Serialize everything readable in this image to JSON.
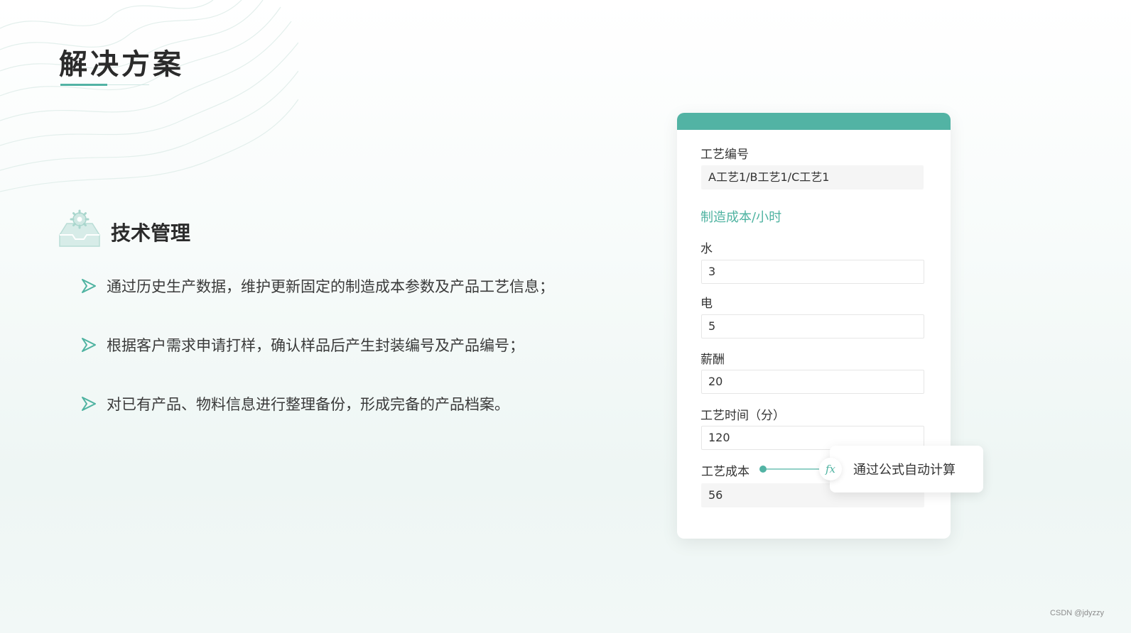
{
  "page": {
    "title": "解决方案"
  },
  "section": {
    "title": "技术管理",
    "bullets": [
      "通过历史生产数据，维护更新固定的制造成本参数及产品工艺信息；",
      "根据客户需求申请打样，确认样品后产生封装编号及产品编号；",
      "对已有产品、物料信息进行整理备份，形成完备的产品档案。"
    ]
  },
  "card": {
    "process_no_label": "工艺编号",
    "process_no_value": "A工艺1/B工艺1/C工艺1",
    "cost_section_label": "制造成本/小时",
    "water_label": "水",
    "water_value": "3",
    "electric_label": "电",
    "electric_value": "5",
    "salary_label": "薪酬",
    "salary_value": "20",
    "time_label": "工艺时间（分）",
    "time_value": "120",
    "cost_label": "工艺成本",
    "cost_value": "56",
    "formula_icon": "fx",
    "tooltip_text": "通过公式自动计算"
  },
  "colors": {
    "accent": "#52b3a4",
    "accent_text": "#4fb3a1"
  },
  "watermark": "CSDN @jdyzzy"
}
